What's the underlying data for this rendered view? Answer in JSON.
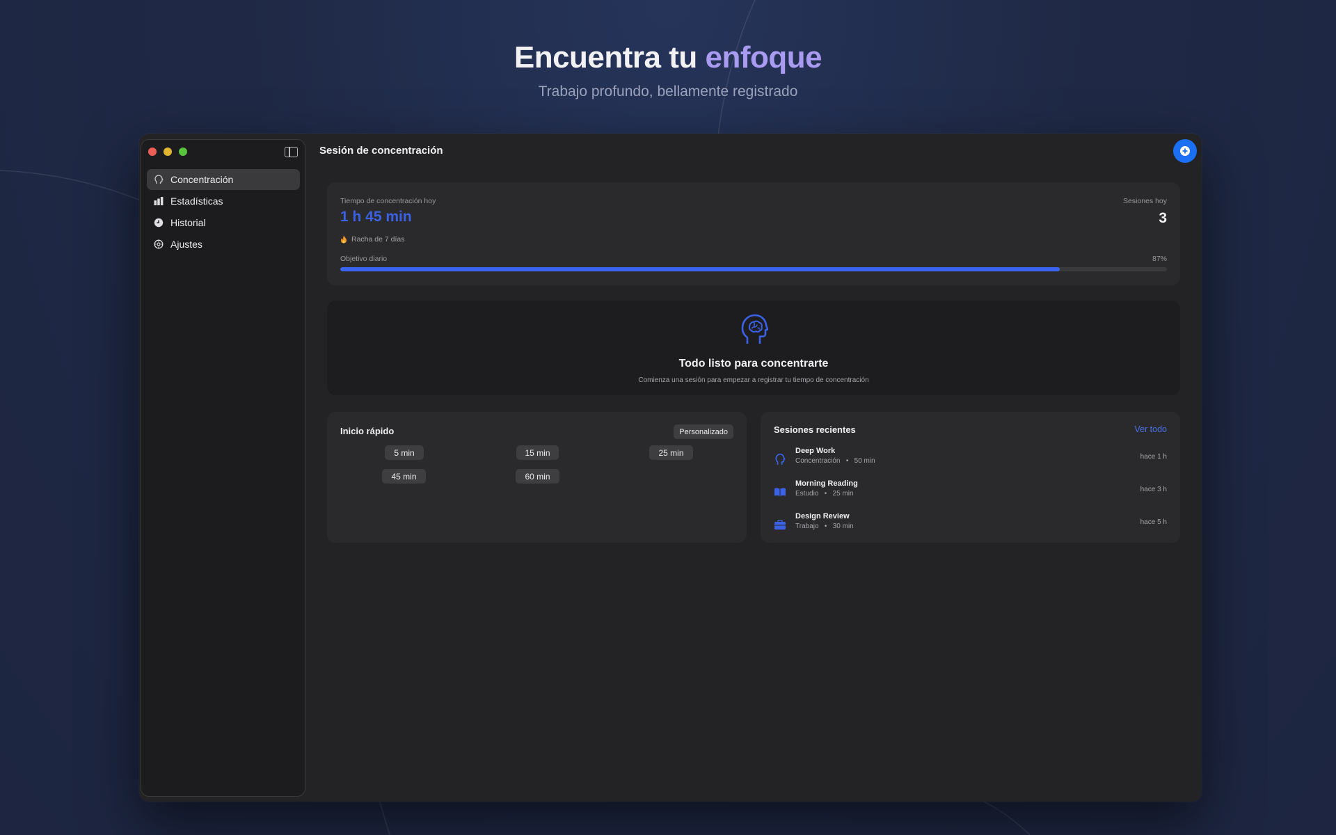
{
  "hero": {
    "title_prefix": "Encuentra tu ",
    "title_accent": "enfoque",
    "subtitle": "Trabajo profundo, bellamente registrado"
  },
  "colors": {
    "accent": "#3b65f0",
    "hero_accent": "#a99bf0",
    "add_button": "#1a6ff4",
    "link": "#4a73ea"
  },
  "sidebar": {
    "items": [
      {
        "label": "Concentración",
        "icon": "head-icon",
        "active": true
      },
      {
        "label": "Estadísticas",
        "icon": "bar-chart-icon",
        "active": false
      },
      {
        "label": "Historial",
        "icon": "clock-icon",
        "active": false
      },
      {
        "label": "Ajustes",
        "icon": "gear-icon",
        "active": false
      }
    ]
  },
  "main": {
    "title": "Sesión de concentración"
  },
  "stats": {
    "focus_label": "Tiempo de concentración hoy",
    "focus_value": "1 h 45 min",
    "sessions_label": "Sesiones hoy",
    "sessions_value": "3",
    "streak": "Racha de 7 días",
    "goal_label": "Objetivo diario",
    "goal_percent_text": "87%",
    "goal_fraction": 0.87
  },
  "ready": {
    "title": "Todo listo para concentrarte",
    "subtitle": "Comienza una sesión para empezar a registrar tu tiempo de concentración"
  },
  "quick_start": {
    "title": "Inicio rápido",
    "custom_label": "Personalizado",
    "durations": [
      "5 min",
      "15 min",
      "25 min",
      "45 min",
      "60 min"
    ]
  },
  "recent": {
    "title": "Sesiones recientes",
    "see_all": "Ver todo",
    "sessions": [
      {
        "name": "Deep Work",
        "category": "Concentración",
        "duration": "50 min",
        "time": "hace 1 h",
        "icon": "head-icon"
      },
      {
        "name": "Morning Reading",
        "category": "Estudio",
        "duration": "25 min",
        "time": "hace 3 h",
        "icon": "book-icon"
      },
      {
        "name": "Design Review",
        "category": "Trabajo",
        "duration": "30 min",
        "time": "hace 5 h",
        "icon": "briefcase-icon"
      }
    ]
  }
}
